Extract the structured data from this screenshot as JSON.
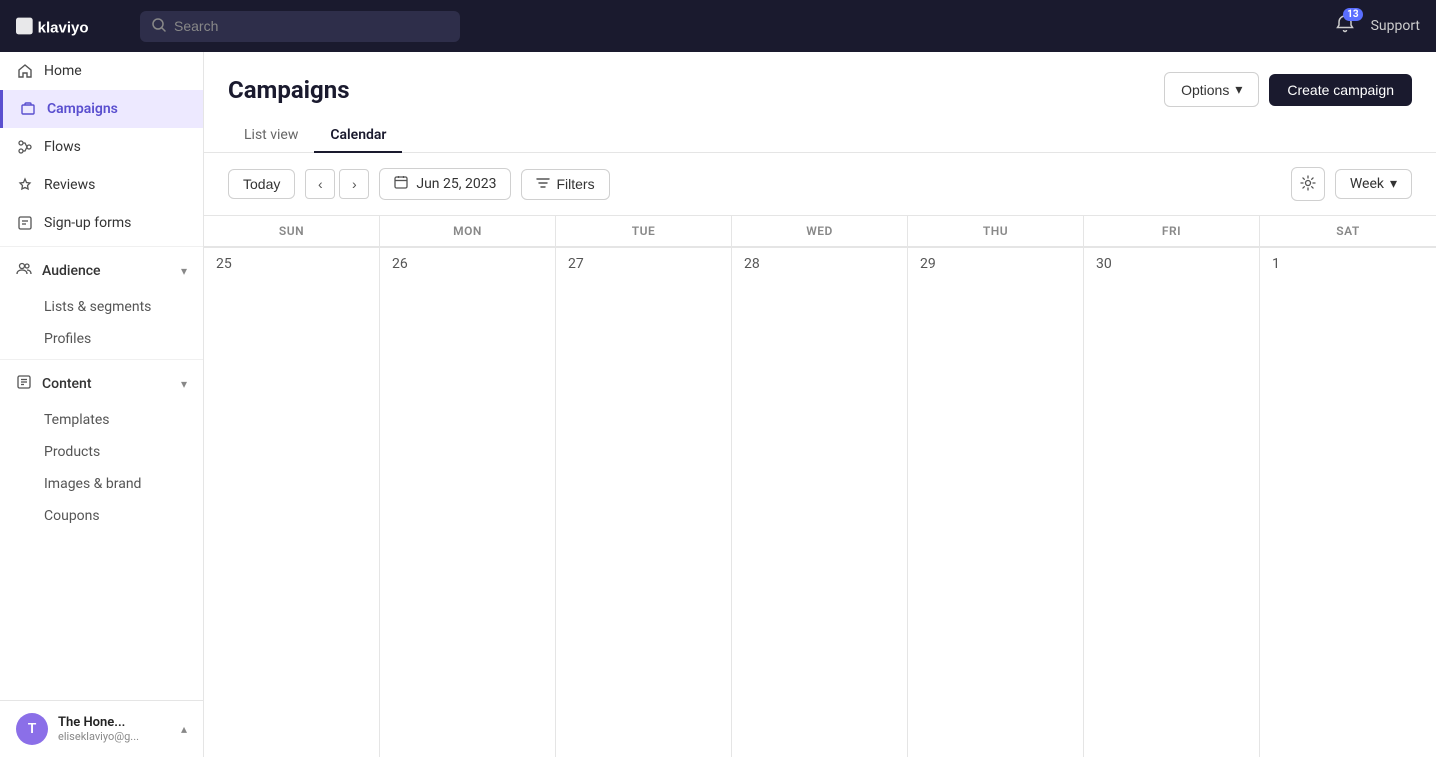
{
  "topnav": {
    "logo": "klaviyo",
    "search_placeholder": "Search",
    "notification_count": "13",
    "support_label": "Support"
  },
  "sidebar": {
    "items": [
      {
        "id": "home",
        "label": "Home",
        "icon": "home-icon",
        "active": false
      },
      {
        "id": "campaigns",
        "label": "Campaigns",
        "icon": "campaigns-icon",
        "active": true
      },
      {
        "id": "flows",
        "label": "Flows",
        "icon": "flows-icon",
        "active": false
      },
      {
        "id": "reviews",
        "label": "Reviews",
        "icon": "reviews-icon",
        "active": false
      },
      {
        "id": "sign-up-forms",
        "label": "Sign-up forms",
        "icon": "forms-icon",
        "active": false
      },
      {
        "id": "audience",
        "label": "Audience",
        "icon": "audience-icon",
        "active": false,
        "expandable": true
      },
      {
        "id": "lists-segments",
        "label": "Lists & segments",
        "icon": "",
        "sub": true
      },
      {
        "id": "profiles",
        "label": "Profiles",
        "icon": "",
        "sub": true
      },
      {
        "id": "content",
        "label": "Content",
        "icon": "content-icon",
        "active": false,
        "expandable": true
      },
      {
        "id": "templates",
        "label": "Templates",
        "icon": "",
        "sub": true
      },
      {
        "id": "products",
        "label": "Products",
        "icon": "",
        "sub": true
      },
      {
        "id": "images-brand",
        "label": "Images & brand",
        "icon": "",
        "sub": true
      },
      {
        "id": "coupons",
        "label": "Coupons",
        "icon": "",
        "sub": true
      }
    ],
    "user": {
      "avatar_letter": "T",
      "name": "The Hone...",
      "email": "eliseklaviyo@g..."
    }
  },
  "page": {
    "title": "Campaigns",
    "options_label": "Options",
    "create_label": "Create campaign"
  },
  "tabs": [
    {
      "id": "list-view",
      "label": "List view",
      "active": false
    },
    {
      "id": "calendar",
      "label": "Calendar",
      "active": true
    }
  ],
  "toolbar": {
    "today_label": "Today",
    "date_display": "Jun 25, 2023",
    "filters_label": "Filters",
    "week_label": "Week"
  },
  "calendar": {
    "days_header": [
      "SUN",
      "MON",
      "TUE",
      "WED",
      "THU",
      "FRI",
      "SAT"
    ],
    "day_numbers": [
      "25",
      "26",
      "27",
      "28",
      "29",
      "30",
      "1"
    ]
  }
}
